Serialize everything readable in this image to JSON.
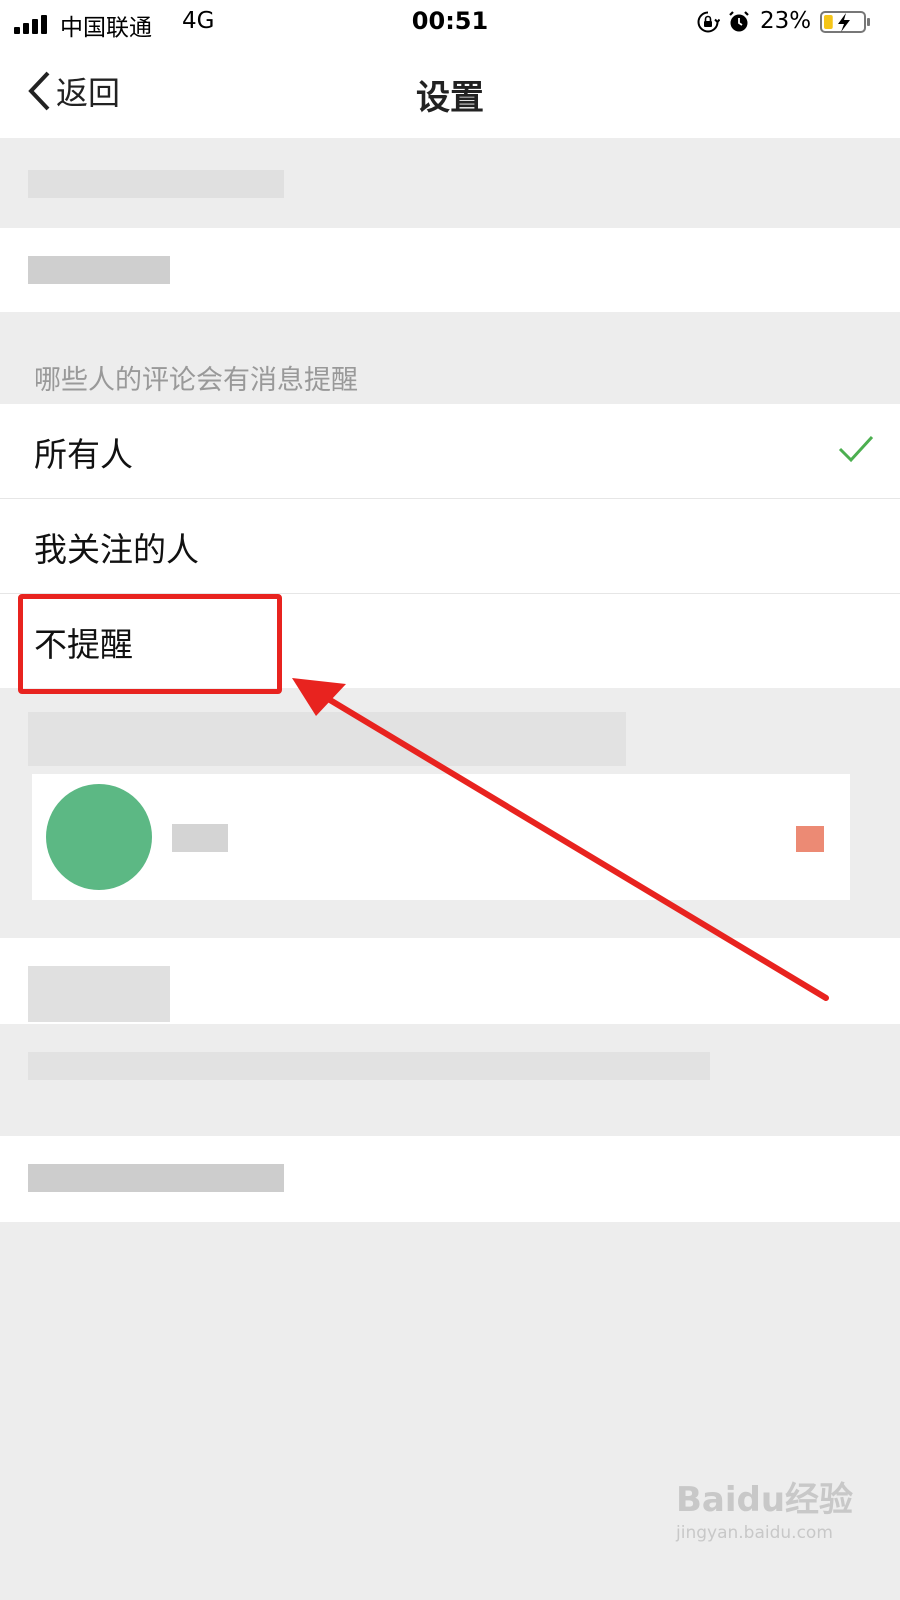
{
  "status_bar": {
    "carrier": "中国联通",
    "network": "4G",
    "time": "00:51",
    "battery_percent": "23%",
    "battery_level": 0.23,
    "battery_state": "charging"
  },
  "nav": {
    "back_label": "返回",
    "title": "设置"
  },
  "comment_notifications": {
    "section_title": "哪些人的评论会有消息提醒",
    "options": [
      {
        "label": "所有人",
        "selected": true
      },
      {
        "label": "我关注的人",
        "selected": false
      },
      {
        "label": "不提醒",
        "selected": false
      }
    ]
  },
  "annotation": {
    "highlighted_option": "不提醒",
    "color": "#e8231f"
  },
  "colors": {
    "check": "#4caf50",
    "background": "#ededed"
  },
  "watermark": {
    "logo": "Baidu经验",
    "url": "jingyan.baidu.com"
  }
}
